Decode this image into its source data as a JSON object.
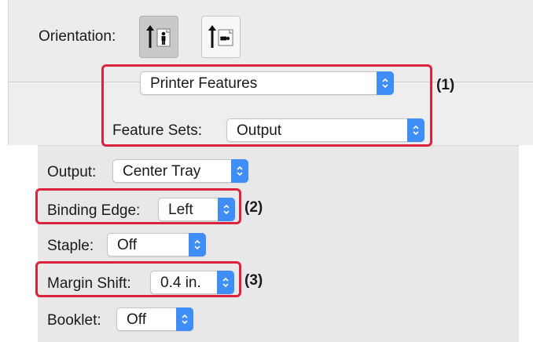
{
  "orientation": {
    "label": "Orientation:",
    "options": [
      {
        "name": "portrait",
        "selected": true
      },
      {
        "name": "landscape",
        "selected": false
      }
    ]
  },
  "panel_select": {
    "value": "Printer Features"
  },
  "feature_sets": {
    "label": "Feature Sets:",
    "value": "Output"
  },
  "output": {
    "label": "Output:",
    "value": "Center Tray"
  },
  "binding_edge": {
    "label": "Binding Edge:",
    "value": "Left"
  },
  "staple": {
    "label": "Staple:",
    "value": "Off"
  },
  "margin_shift": {
    "label": "Margin Shift:",
    "value": "0.4 in."
  },
  "booklet": {
    "label": "Booklet:",
    "value": "Off"
  },
  "callouts": {
    "one": "(1)",
    "two": "(2)",
    "three": "(3)"
  },
  "colors": {
    "accent": "#3f8ef7",
    "callout": "#d9233f"
  }
}
